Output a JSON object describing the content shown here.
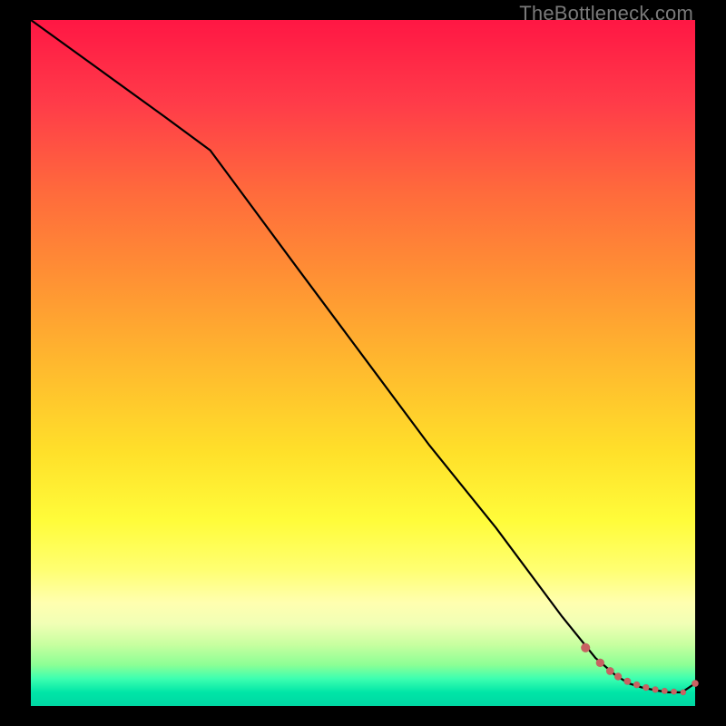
{
  "watermark": "TheBottleneck.com",
  "chart_data": {
    "type": "line",
    "title": "",
    "xlabel": "",
    "ylabel": "",
    "xlim": [
      0,
      100
    ],
    "ylim": [
      0,
      100
    ],
    "grid": false,
    "legend": false,
    "series": [
      {
        "name": "bottleneck-curve",
        "x": [
          0,
          10,
          20,
          27,
          40,
          50,
          60,
          70,
          80,
          85,
          88,
          90,
          92,
          94,
          96,
          98,
          100
        ],
        "y": [
          100,
          93,
          86,
          81,
          64,
          51,
          38,
          26,
          13,
          7,
          4.5,
          3.3,
          2.7,
          2.3,
          2,
          2,
          3.3
        ]
      }
    ],
    "markers": {
      "name": "optimal-range-dots",
      "x": [
        83.5,
        85.7,
        87.2,
        88.4,
        89.8,
        91.2,
        92.6,
        94.0,
        95.4,
        96.8,
        98.2,
        100
      ],
      "y": [
        8.5,
        6.3,
        5.1,
        4.3,
        3.6,
        3.1,
        2.7,
        2.4,
        2.2,
        2.1,
        2.0,
        3.3
      ],
      "r": [
        5.0,
        4.6,
        4.3,
        4.1,
        3.9,
        3.7,
        3.6,
        3.5,
        3.4,
        3.3,
        3.2,
        3.8
      ]
    }
  }
}
